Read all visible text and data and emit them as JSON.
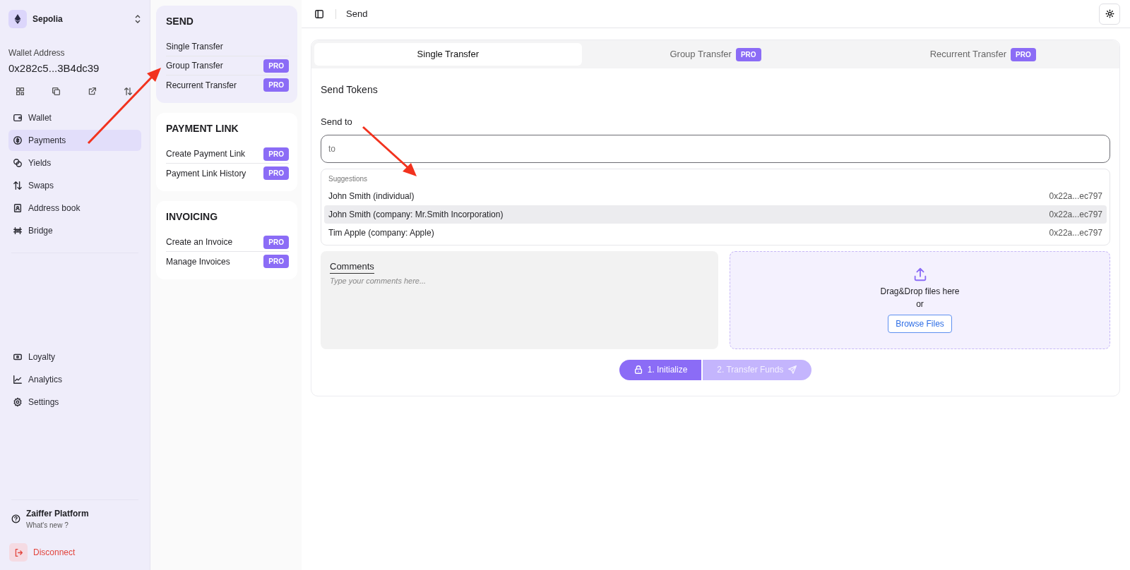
{
  "network": {
    "name": "Sepolia"
  },
  "wallet": {
    "label": "Wallet Address",
    "address": "0x282c5...3B4dc39"
  },
  "nav_top": [
    {
      "label": "Wallet",
      "selected": false
    },
    {
      "label": "Payments",
      "selected": true
    },
    {
      "label": "Yields",
      "selected": false
    },
    {
      "label": "Swaps",
      "selected": false
    },
    {
      "label": "Address book",
      "selected": false
    },
    {
      "label": "Bridge",
      "selected": false
    }
  ],
  "nav_bottom": [
    {
      "label": "Loyalty",
      "selected": false
    },
    {
      "label": "Analytics",
      "selected": false
    },
    {
      "label": "Settings",
      "selected": false
    }
  ],
  "platform": {
    "title": "Zaiffer Platform",
    "subtitle": "What's new ?"
  },
  "disconnect": {
    "label": "Disconnect"
  },
  "sections": [
    {
      "title": "SEND",
      "selected": true,
      "items": [
        {
          "label": "Single Transfer"
        },
        {
          "label": "Group Transfer",
          "badge": "PRO"
        },
        {
          "label": "Recurrent Transfer",
          "badge": "PRO"
        }
      ]
    },
    {
      "title": "PAYMENT LINK",
      "selected": false,
      "items": [
        {
          "label": "Create Payment Link",
          "badge": "PRO"
        },
        {
          "label": "Payment Link History",
          "badge": "PRO"
        }
      ]
    },
    {
      "title": "INVOICING",
      "selected": false,
      "items": [
        {
          "label": "Create an Invoice",
          "badge": "PRO"
        },
        {
          "label": "Manage Invoices",
          "badge": "PRO"
        }
      ]
    }
  ],
  "breadcrumb": "Send",
  "tabs": [
    {
      "label": "Single Transfer",
      "selected": true
    },
    {
      "label": "Group Transfer",
      "badge": "PRO",
      "selected": false
    },
    {
      "label": "Recurrent Transfer",
      "badge": "PRO",
      "selected": false
    }
  ],
  "form": {
    "title": "Send Tokens",
    "send_to_label": "Send to",
    "send_to_placeholder": "to",
    "suggestions_heading": "Suggestions",
    "suggestions": [
      {
        "name": "John Smith (individual)",
        "address": "0x22a...ec797",
        "selected": false
      },
      {
        "name": "John Smith (company: Mr.Smith Incorporation)",
        "address": "0x22a...ec797",
        "selected": true
      },
      {
        "name": "Tim Apple (company: Apple)",
        "address": "0x22a...ec797",
        "selected": false
      }
    ],
    "comments_label": "Comments",
    "comments_placeholder": "Type your comments here...",
    "dropzone": {
      "text": "Drag&Drop files here",
      "or": "or",
      "button": "Browse Files"
    },
    "steps": [
      {
        "label": "1. Initialize",
        "disabled": false
      },
      {
        "label": "2. Transfer Funds",
        "disabled": true
      }
    ]
  }
}
